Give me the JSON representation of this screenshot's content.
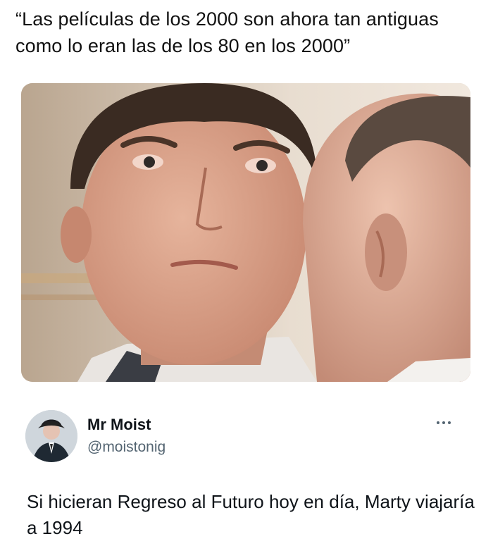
{
  "meme": {
    "caption": "“Las películas de los 2000 son ahora tan antiguas como lo eran las de los 80 en los 2000”",
    "photo_icon": "photo-two-men"
  },
  "tweet": {
    "display_name": "Mr Moist",
    "handle": "@moistonig",
    "text": "Si hicieran Regreso al Futuro hoy en día, Marty viajaría a 1994",
    "avatar_icon": "avatar-man-in-suit",
    "more_icon": "more-dots-icon"
  },
  "colors": {
    "text_primary": "#0f1419",
    "text_secondary": "#536471",
    "background": "#ffffff"
  }
}
